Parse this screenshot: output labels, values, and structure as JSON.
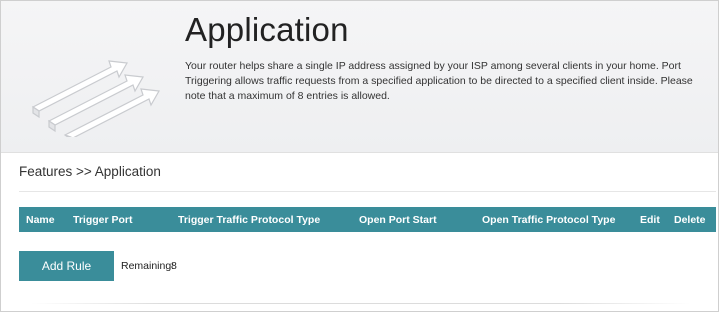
{
  "header": {
    "title": "Application",
    "description": "Your router helps share a single IP address assigned by your ISP among several clients in your home. Port Triggering allows traffic requests from a specified application to be directed to a specified client inside. Please note that a maximum of 8 entries is allowed."
  },
  "breadcrumb": "Features >> Application",
  "table": {
    "columns": [
      "Name",
      "Trigger Port",
      "Trigger Traffic Protocol Type",
      "Open Port Start",
      "Open Traffic Protocol Type",
      "Edit",
      "Delete"
    ]
  },
  "actions": {
    "add_rule_label": "Add Rule",
    "remaining_label": "Remaining:",
    "remaining_count": "8"
  },
  "colors": {
    "accent": "#3a8d9a",
    "header_bg": "#f2f2f4"
  }
}
